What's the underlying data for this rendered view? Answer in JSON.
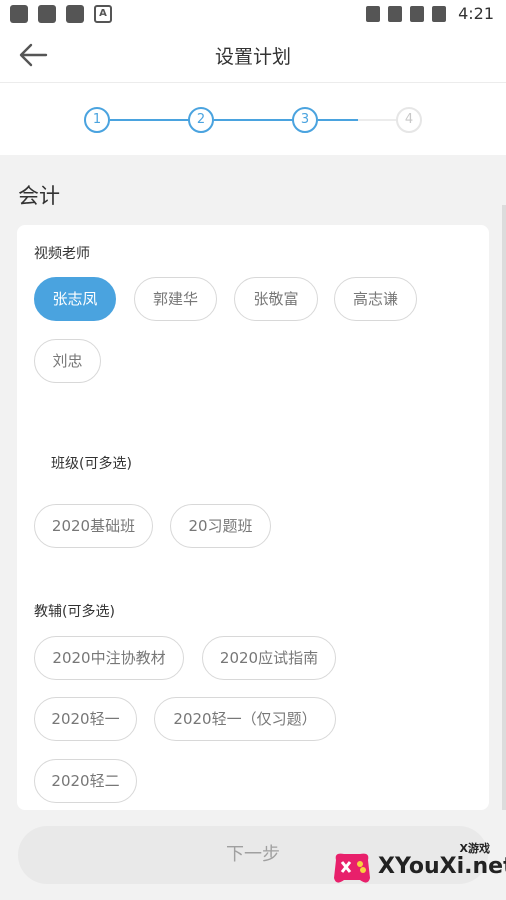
{
  "statusbar": {
    "time": "4:21"
  },
  "header": {
    "title": "设置计划"
  },
  "stepper": {
    "steps": [
      "1",
      "2",
      "3",
      "4"
    ],
    "current_step": 3
  },
  "subject": "会计",
  "teachers": {
    "label": "视频老师",
    "items": [
      "张志凤",
      "郭建华",
      "张敬富",
      "高志谦",
      "刘忠"
    ],
    "selected": "张志凤"
  },
  "classes": {
    "label": "班级(可多选)",
    "items": [
      "2020基础班",
      "20习题班"
    ]
  },
  "materials": {
    "label": "教辅(可多选)",
    "items": [
      "2020中注协教材",
      "2020应试指南",
      "2020轻一",
      "2020轻一（仅习题）",
      "2020轻二"
    ]
  },
  "footer": {
    "next_label": "下一步"
  },
  "watermark": {
    "text": "XYouXi.net",
    "small": "X游戏"
  },
  "colors": {
    "accent": "#4aa3df",
    "background": "#f2f2f2"
  }
}
